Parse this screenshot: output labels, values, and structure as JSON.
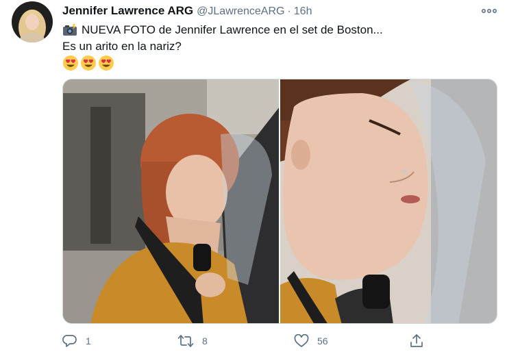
{
  "tweet": {
    "display_name": "Jennifer Lawrence ARG",
    "handle": "@JLawrenceARG",
    "separator": "·",
    "time": "16h",
    "text_line1": "NUEVA FOTO de Jennifer Lawrence en el set de Boston...",
    "text_line2": "Es un arito en la nariz?",
    "emoji_line": [
      "smiling-face-with-heart-eyes",
      "smiling-face-with-heart-eyes",
      "smiling-face-with-heart-eyes"
    ],
    "prefix_icon": "camera-with-flash"
  },
  "actions": {
    "reply_count": "1",
    "retweet_count": "8",
    "like_count": "56"
  },
  "icons": {
    "more": "more-horizontal-icon",
    "reply": "reply-icon",
    "retweet": "retweet-icon",
    "like": "heart-icon",
    "share": "share-icon"
  },
  "colors": {
    "secondary_text": "#5b7083",
    "primary_text": "#0f1419",
    "border": "#cfd9de"
  }
}
